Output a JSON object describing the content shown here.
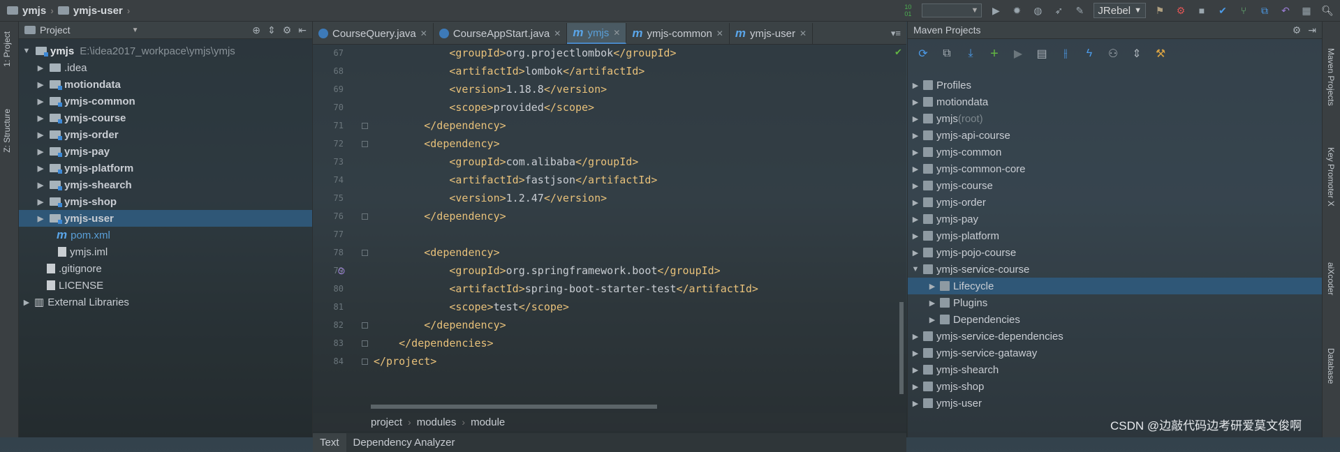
{
  "topbar": {
    "crumbs": [
      "ymjs",
      "ymjs-user"
    ],
    "run_config": "JRebel"
  },
  "left_strip": {
    "tabs": [
      "1: Project",
      "Z: Structure"
    ]
  },
  "right_strip": {
    "tabs": [
      "Maven Projects",
      "Key Promoter X",
      "aiXcoder",
      "Database"
    ]
  },
  "project": {
    "header": "Project",
    "root": {
      "name": "ymjs",
      "path": "E:\\idea2017_workpace\\ymjs\\ymjs"
    },
    "items": [
      {
        "label": ".idea"
      },
      {
        "label": "motiondata"
      },
      {
        "label": "ymjs-common"
      },
      {
        "label": "ymjs-course"
      },
      {
        "label": "ymjs-order"
      },
      {
        "label": "ymjs-pay"
      },
      {
        "label": "ymjs-platform"
      },
      {
        "label": "ymjs-shearch"
      },
      {
        "label": "ymjs-shop"
      },
      {
        "label": "ymjs-user"
      },
      {
        "label": "pom.xml"
      },
      {
        "label": "ymjs.iml"
      },
      {
        "label": ".gitignore"
      },
      {
        "label": "LICENSE"
      },
      {
        "label": "External Libraries"
      }
    ]
  },
  "editor": {
    "tabs": [
      {
        "label": "CourseQuery.java"
      },
      {
        "label": "CourseAppStart.java"
      },
      {
        "label": "ymjs"
      },
      {
        "label": "ymjs-common"
      },
      {
        "label": "ymjs-user"
      }
    ],
    "line_numbers": [
      "67",
      "68",
      "69",
      "70",
      "71",
      "72",
      "73",
      "74",
      "75",
      "76",
      "77",
      "78",
      "79",
      "80",
      "81",
      "82",
      "83",
      "84"
    ],
    "lines": [
      {
        "indent": "            ",
        "open": "<groupId>",
        "text": "org.projectlombok",
        "close": "</groupId>"
      },
      {
        "indent": "            ",
        "open": "<artifactId>",
        "text": "lombok",
        "close": "</artifactId>"
      },
      {
        "indent": "            ",
        "open": "<version>",
        "text": "1.18.8",
        "close": "</version>"
      },
      {
        "indent": "            ",
        "open": "<scope>",
        "text": "provided",
        "close": "</scope>"
      },
      {
        "indent": "        ",
        "open": "</dependency>",
        "text": "",
        "close": ""
      },
      {
        "indent": "        ",
        "open": "<dependency>",
        "text": "",
        "close": ""
      },
      {
        "indent": "            ",
        "open": "<groupId>",
        "text": "com.alibaba",
        "close": "</groupId>"
      },
      {
        "indent": "            ",
        "open": "<artifactId>",
        "text": "fastjson",
        "close": "</artifactId>"
      },
      {
        "indent": "            ",
        "open": "<version>",
        "text": "1.2.47",
        "close": "</version>"
      },
      {
        "indent": "        ",
        "open": "</dependency>",
        "text": "",
        "close": ""
      },
      {
        "indent": "",
        "open": "",
        "text": "",
        "close": ""
      },
      {
        "indent": "        ",
        "open": "<dependency>",
        "text": "",
        "close": ""
      },
      {
        "indent": "            ",
        "open": "<groupId>",
        "text": "org.springframework.boot",
        "close": "</groupId>"
      },
      {
        "indent": "            ",
        "open": "<artifactId>",
        "text": "spring-boot-starter-test",
        "close": "</artifactId>"
      },
      {
        "indent": "            ",
        "open": "<scope>",
        "text": "test",
        "close": "</scope>"
      },
      {
        "indent": "        ",
        "open": "</dependency>",
        "text": "",
        "close": ""
      },
      {
        "indent": "    ",
        "open": "</dependencies>",
        "text": "",
        "close": ""
      },
      {
        "indent": "",
        "open": "</project>",
        "text": "",
        "close": ""
      }
    ],
    "breadcrumb": [
      "project",
      "modules",
      "module"
    ],
    "bottom_tabs": [
      "Text",
      "Dependency Analyzer"
    ]
  },
  "maven": {
    "header": "Maven Projects",
    "rows": [
      {
        "label": "Profiles",
        "suffix": ""
      },
      {
        "label": "motiondata",
        "suffix": ""
      },
      {
        "label": "ymjs",
        "suffix": " (root)"
      },
      {
        "label": "ymjs-api-course",
        "suffix": ""
      },
      {
        "label": "ymjs-common",
        "suffix": ""
      },
      {
        "label": "ymjs-common-core",
        "suffix": ""
      },
      {
        "label": "ymjs-course",
        "suffix": ""
      },
      {
        "label": "ymjs-order",
        "suffix": ""
      },
      {
        "label": "ymjs-pay",
        "suffix": ""
      },
      {
        "label": "ymjs-platform",
        "suffix": ""
      },
      {
        "label": "ymjs-pojo-course",
        "suffix": ""
      },
      {
        "label": "ymjs-service-course",
        "suffix": ""
      },
      {
        "label": "Lifecycle",
        "suffix": ""
      },
      {
        "label": "Plugins",
        "suffix": ""
      },
      {
        "label": "Dependencies",
        "suffix": ""
      },
      {
        "label": "ymjs-service-dependencies",
        "suffix": ""
      },
      {
        "label": "ymjs-service-gataway",
        "suffix": ""
      },
      {
        "label": "ymjs-shearch",
        "suffix": ""
      },
      {
        "label": "ymjs-shop",
        "suffix": ""
      },
      {
        "label": "ymjs-user",
        "suffix": ""
      }
    ]
  },
  "watermark": "CSDN @边敲代码边考研爱莫文俊啊",
  "colors": {
    "tag": "#e8c17a",
    "selection": "#2f5777",
    "accent": "#4a88c7"
  }
}
